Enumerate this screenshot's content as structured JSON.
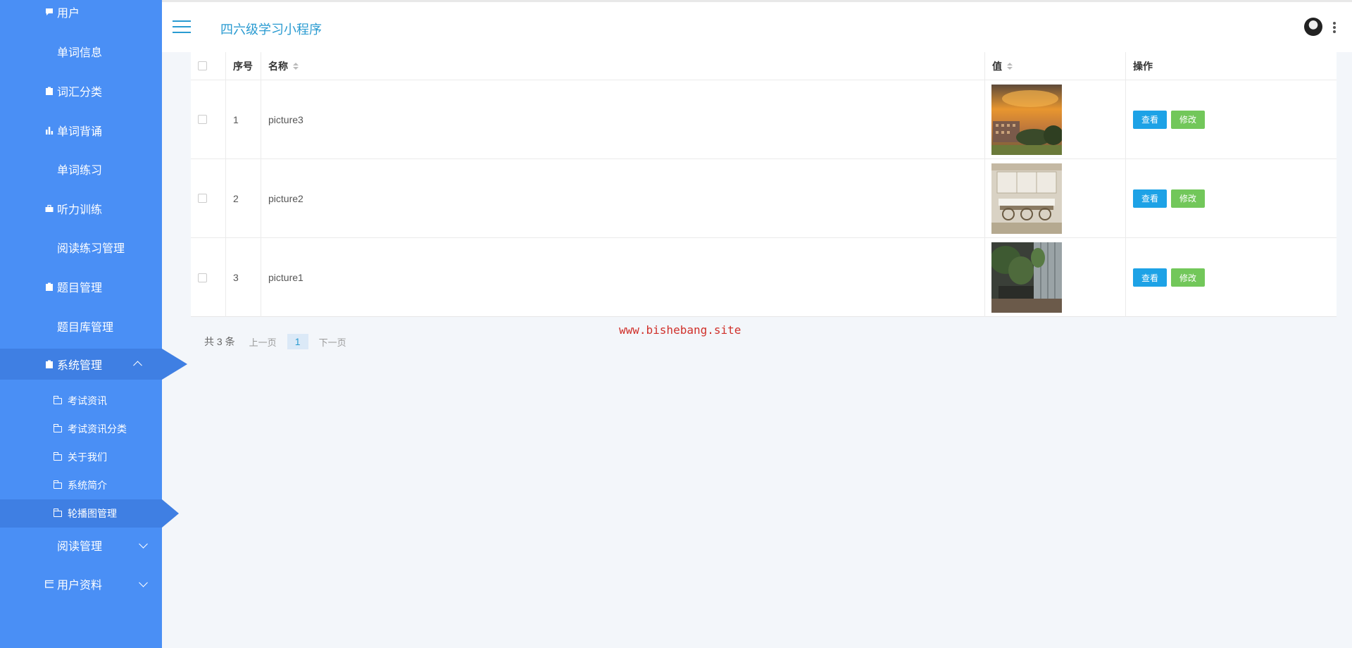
{
  "app": {
    "title": "四六级学习小程序"
  },
  "colors": {
    "sidebar": "#4a8ff5",
    "sidebar_active": "#3f7fe3",
    "accent": "#2a9bd1",
    "view_button": "#1da2e6",
    "edit_button": "#72c75a",
    "watermark": "#d0302a"
  },
  "sidebar": {
    "items": [
      {
        "label": "用户",
        "icon": "comment-icon"
      },
      {
        "label": "单词信息",
        "icon": "grid-icon"
      },
      {
        "label": "词汇分类",
        "icon": "clipboard-icon"
      },
      {
        "label": "单词背诵",
        "icon": "bar-chart-icon"
      },
      {
        "label": "单词练习",
        "icon": "grid-icon"
      },
      {
        "label": "听力训练",
        "icon": "briefcase-icon"
      },
      {
        "label": "阅读练习管理",
        "icon": "grid-icon"
      },
      {
        "label": "题目管理",
        "icon": "clipboard-icon"
      },
      {
        "label": "题目库管理",
        "icon": "grid-icon"
      },
      {
        "label": "系统管理",
        "icon": "clipboard-icon",
        "expanded": true
      },
      {
        "label": "阅读管理",
        "icon": "grid-icon",
        "expanded": false
      },
      {
        "label": "用户资料",
        "icon": "id-card-icon",
        "expanded": false
      }
    ],
    "sub_items": [
      {
        "label": "考试资讯"
      },
      {
        "label": "考试资讯分类"
      },
      {
        "label": "关于我们"
      },
      {
        "label": "系统简介"
      },
      {
        "label": "轮播图管理",
        "active": true
      }
    ]
  },
  "table": {
    "headers": {
      "index": "序号",
      "name": "名称",
      "value": "值",
      "actions": "操作"
    },
    "rows": [
      {
        "index": "1",
        "name": "picture3",
        "image": "sunset-campus-photo"
      },
      {
        "index": "2",
        "name": "picture2",
        "image": "white-room-photo"
      },
      {
        "index": "3",
        "name": "picture1",
        "image": "garden-courtyard-photo"
      }
    ],
    "view_label": "查看",
    "edit_label": "修改"
  },
  "pagination": {
    "total": "共 3 条",
    "prev": "上一页",
    "current": "1",
    "next": "下一页"
  },
  "watermark": "www.bishebang.site"
}
